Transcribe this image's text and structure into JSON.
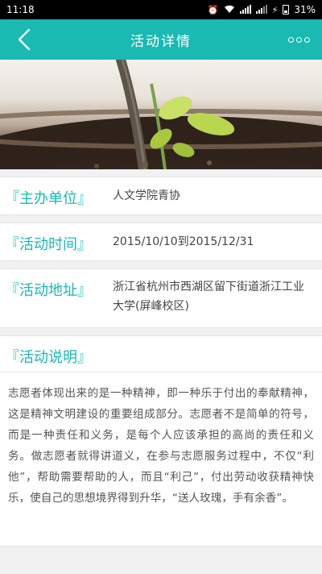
{
  "status_bar": {
    "time": "11:18",
    "battery": "31%",
    "icons": [
      "alarm-icon",
      "wifi-icon",
      "signal-icon",
      "signal-icon",
      "charging-icon",
      "battery-icon"
    ]
  },
  "nav": {
    "title": "活动详情",
    "back_icon": "back-chevron-icon",
    "more_icon": "more-dots-icon",
    "color": "#1ab9b1"
  },
  "details": {
    "organizer": {
      "label": "『主办单位』",
      "value": "人文学院青协"
    },
    "time": {
      "label": "『活动时间』",
      "value": "2015/10/10到2015/12/31"
    },
    "address": {
      "label": "『活动地址』",
      "value": "浙江省杭州市西湖区留下街道浙江工业大学(屏峰校区)"
    },
    "description": {
      "label": "『活动说明』",
      "value": "志愿者体现出来的是一种精神，即一种乐于付出的奉献精神，这是精神文明建设的重要组成部分。志愿者不是简单的符号，而是一种责任和义务，是每个人应该承担的高尚的责任和义务。做志愿者就得讲道义，在参与志愿服务过程中，不仅“利他”，帮助需要帮助的人，而且“利己”，付出劳动收获精神快乐，使自己的思想境界得到升华，“送人玫瑰，手有余香”。"
    }
  }
}
